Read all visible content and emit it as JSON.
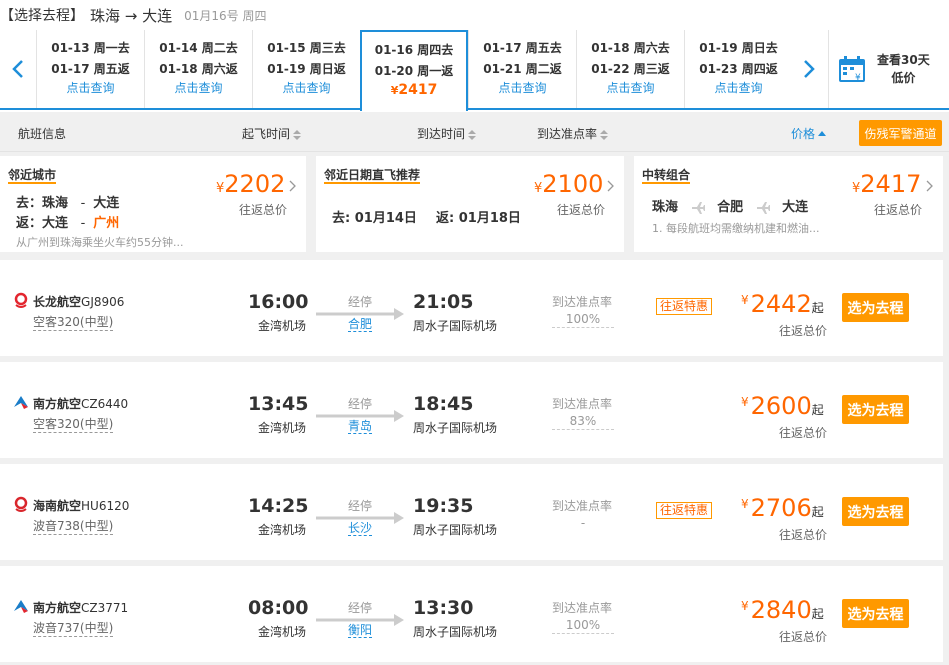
{
  "header": {
    "section_label": "【选择去程】",
    "route": "珠海 → 大连",
    "date": "01月16号 周四"
  },
  "date_strip": {
    "cells": [
      {
        "out": "01-13 周一去",
        "back": "01-17 周五返",
        "price": "点击查询",
        "active": false
      },
      {
        "out": "01-14 周二去",
        "back": "01-18 周六返",
        "price": "点击查询",
        "active": false
      },
      {
        "out": "01-15 周三去",
        "back": "01-19 周日返",
        "price": "点击查询",
        "active": false
      },
      {
        "out": "01-16 周四去",
        "back": "01-20 周一返",
        "price": "2417",
        "currency": "¥",
        "active": true
      },
      {
        "out": "01-17 周五去",
        "back": "01-21 周二返",
        "price": "点击查询",
        "active": false
      },
      {
        "out": "01-18 周六去",
        "back": "01-22 周三返",
        "price": "点击查询",
        "active": false
      },
      {
        "out": "01-19 周日去",
        "back": "01-23 周四返",
        "price": "点击查询",
        "active": false
      }
    ],
    "calendar_label_1": "查看30天",
    "calendar_label_2": "低价"
  },
  "columns": {
    "flight_info": "航班信息",
    "dep_time": "起飞时间",
    "arr_time": "到达时间",
    "on_time": "到达准点率",
    "price": "价格",
    "military_button": "伤残军警通道"
  },
  "recommendations": {
    "nearby_city": {
      "title": "邻近城市",
      "price": "2202",
      "currency": "¥",
      "price_sub": "往返总价",
      "go_label": "去：",
      "go_from": "珠海",
      "go_sep": "-",
      "go_to": "大连",
      "back_label": "返：",
      "back_from": "大连",
      "back_sep": "-",
      "back_to": "广州",
      "note": "从广州到珠海乘坐火车约55分钟..."
    },
    "nearby_date": {
      "title": "邻近日期直飞推荐",
      "price": "2100",
      "currency": "¥",
      "price_sub": "往返总价",
      "go": "去: 01月14日",
      "back": "返: 01月18日"
    },
    "transfer": {
      "title": "中转组合",
      "price": "2417",
      "currency": "¥",
      "price_sub": "往返总价",
      "city1": "珠海",
      "city2": "合肥",
      "city3": "大连",
      "note": "1. 每段航班均需缴纳机建和燃油..."
    }
  },
  "flights": [
    {
      "airline": "长龙航空",
      "flight_no": "GJ8906",
      "aircraft": "空客320(中型)",
      "dep_time": "16:00",
      "dep_airport": "金湾机场",
      "stop_label": "经停",
      "stop_city": "合肥",
      "arr_time": "21:05",
      "arr_airport": "周水子国际机场",
      "otp_label": "到达准点率",
      "otp": "100%",
      "tag": "往返特惠",
      "currency": "¥",
      "price": "2442",
      "price_suffix": "起",
      "price_sub": "往返总价",
      "button": "选为去程",
      "logo_color": "#e3262f"
    },
    {
      "airline": "南方航空",
      "flight_no": "CZ6440",
      "aircraft": "空客320(中型)",
      "dep_time": "13:45",
      "dep_airport": "金湾机场",
      "stop_label": "经停",
      "stop_city": "青岛",
      "arr_time": "18:45",
      "arr_airport": "周水子国际机场",
      "otp_label": "到达准点率",
      "otp": "83%",
      "tag": "",
      "currency": "¥",
      "price": "2600",
      "price_suffix": "起",
      "price_sub": "往返总价",
      "button": "选为去程",
      "logo_color": "#1a7dc8"
    },
    {
      "airline": "海南航空",
      "flight_no": "HU6120",
      "aircraft": "波音738(中型)",
      "dep_time": "14:25",
      "dep_airport": "金湾机场",
      "stop_label": "经停",
      "stop_city": "长沙",
      "arr_time": "19:35",
      "arr_airport": "周水子国际机场",
      "otp_label": "到达准点率",
      "otp": "-",
      "tag": "往返特惠",
      "currency": "¥",
      "price": "2706",
      "price_suffix": "起",
      "price_sub": "往返总价",
      "button": "选为去程",
      "logo_color": "#d9262c"
    },
    {
      "airline": "南方航空",
      "flight_no": "CZ3771",
      "aircraft": "波音737(中型)",
      "dep_time": "08:00",
      "dep_airport": "金湾机场",
      "stop_label": "经停",
      "stop_city": "衡阳",
      "arr_time": "13:30",
      "arr_airport": "周水子国际机场",
      "otp_label": "到达准点率",
      "otp": "100%",
      "tag": "",
      "currency": "¥",
      "price": "2840",
      "price_suffix": "起",
      "price_sub": "往返总价",
      "button": "选为去程",
      "logo_color": "#1a7dc8"
    }
  ],
  "colors": {
    "accent_blue": "#1e8ed9",
    "price_orange": "#ff6600",
    "button_orange": "#ff9900"
  }
}
